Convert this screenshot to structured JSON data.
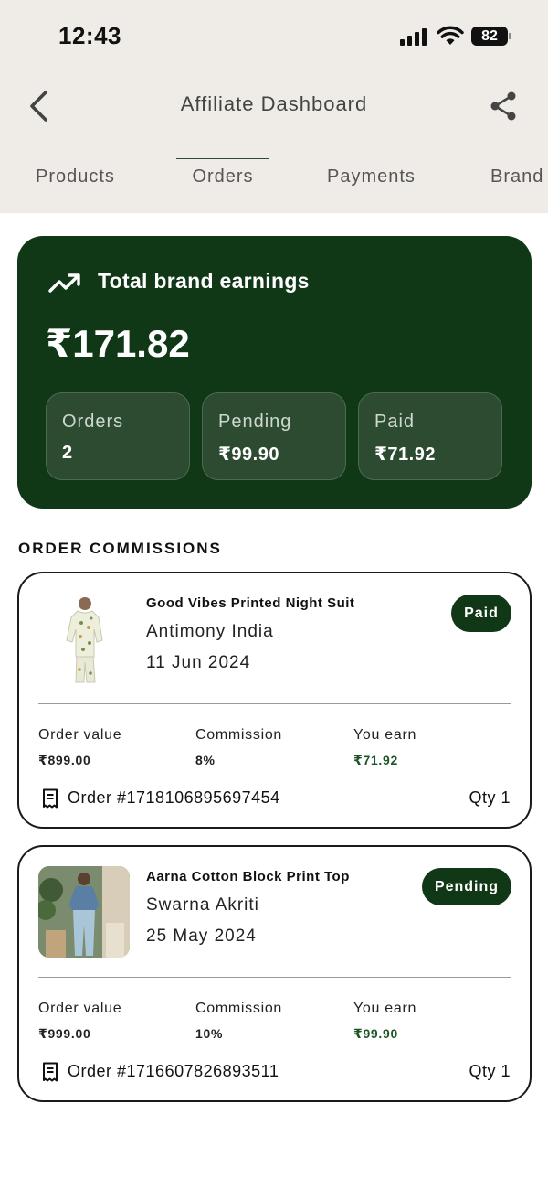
{
  "status_bar": {
    "time": "12:43",
    "battery": "82"
  },
  "header": {
    "title": "Affiliate Dashboard"
  },
  "tabs": [
    {
      "label": "Products"
    },
    {
      "label": "Orders"
    },
    {
      "label": "Payments"
    },
    {
      "label": "Brand"
    }
  ],
  "active_tab": "Orders",
  "earnings": {
    "label": "Total brand earnings",
    "total": "₹171.82",
    "stats": [
      {
        "label": "Orders",
        "value": "2"
      },
      {
        "label": "Pending",
        "value": "₹99.90"
      },
      {
        "label": "Paid",
        "value": "₹71.92"
      }
    ]
  },
  "section_title": "ORDER COMMISSIONS",
  "orders": [
    {
      "product": "Good Vibes Printed Night Suit",
      "brand": "Antimony India",
      "date": "11 Jun 2024",
      "status": "Paid",
      "order_value_label": "Order value",
      "order_value": "₹899.00",
      "commission_label": "Commission",
      "commission": "8%",
      "earn_label": "You earn",
      "earn": "₹71.92",
      "order_id": "Order #1718106895697454",
      "qty": "Qty 1"
    },
    {
      "product": "Aarna Cotton Block Print Top",
      "brand": "Swarna Akriti",
      "date": "25 May 2024",
      "status": "Pending",
      "order_value_label": "Order value",
      "order_value": "₹999.00",
      "commission_label": "Commission",
      "commission": "10%",
      "earn_label": "You earn",
      "earn": "₹99.90",
      "order_id": "Order #1716607826893511",
      "qty": "Qty 1"
    }
  ],
  "colors": {
    "primary_green": "#113816",
    "header_bg": "#efece7",
    "stat_box": "#2c4b31",
    "earn_text": "#1d5526"
  }
}
